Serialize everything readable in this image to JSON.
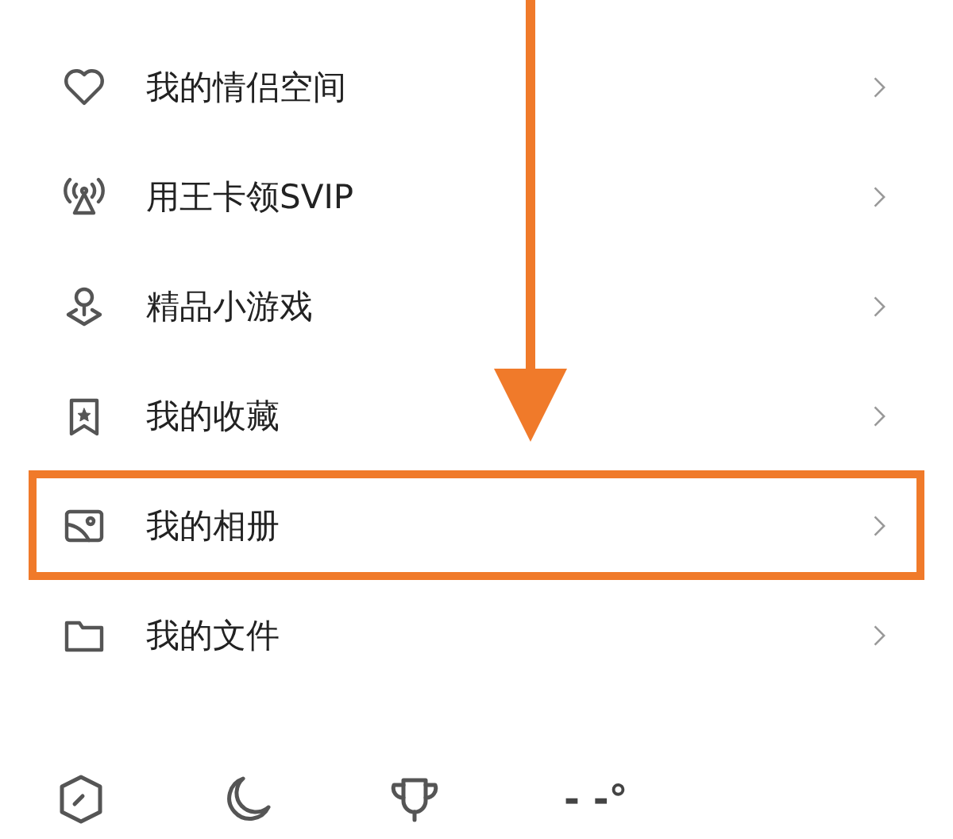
{
  "menu": [
    {
      "kind": "heart",
      "label": "我的情侣空间",
      "highlighted": false
    },
    {
      "kind": "antenna",
      "label": "用王卡领SVIP",
      "highlighted": false
    },
    {
      "kind": "game",
      "label": "精品小游戏",
      "highlighted": false
    },
    {
      "kind": "bookmark",
      "label": "我的收藏",
      "highlighted": false
    },
    {
      "kind": "photo",
      "label": "我的相册",
      "highlighted": true
    },
    {
      "kind": "folder",
      "label": "我的文件",
      "highlighted": false
    }
  ],
  "bottom_bar": [
    {
      "kind": "shield"
    },
    {
      "kind": "moon"
    },
    {
      "kind": "trophy"
    },
    {
      "kind": "weather",
      "text": "- -°"
    }
  ]
}
